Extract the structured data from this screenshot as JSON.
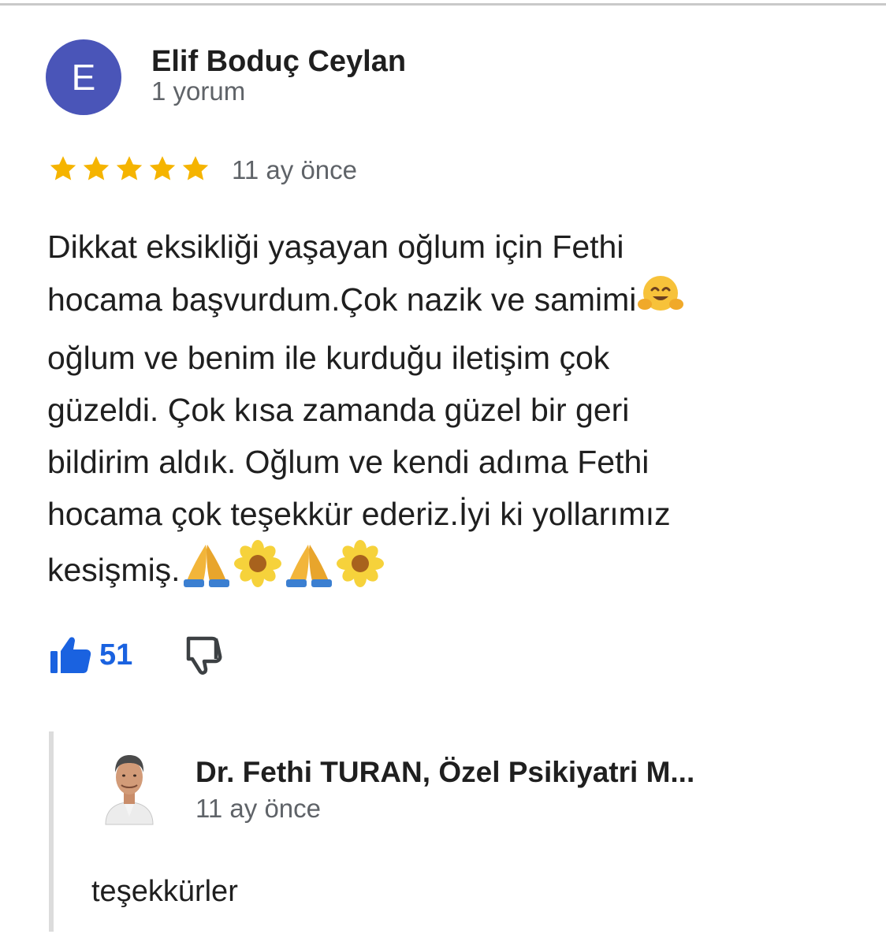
{
  "reviewer": {
    "initial": "E",
    "name": "Elif Boduç Ceylan",
    "meta": "1 yorum",
    "avatar_color": "#4a55b8"
  },
  "review": {
    "rating": 5,
    "max_rating": 5,
    "time": "11 ay önce",
    "lines": [
      "Dikkat eksikliği yaşayan oğlum için Fethi",
      "hocama başvurdum.Çok nazik ve samimi",
      "oğlum ve benim ile kurduğu iletişim çok",
      "güzeldi. Çok kısa zamanda güzel bir geri",
      "bildirim aldık. Oğlum ve kendi adıma Fethi",
      "hocama çok teşekkür ederiz.İyi ki yollarımız",
      "kesişmiş."
    ],
    "star_color": "#f5b400"
  },
  "reactions": {
    "like_count": "51",
    "like_color": "#1a62e0"
  },
  "reply": {
    "name": "Dr. Fethi TURAN, Özel Psikiyatri M...",
    "time": "11 ay önce",
    "text": "teşekkürler"
  }
}
